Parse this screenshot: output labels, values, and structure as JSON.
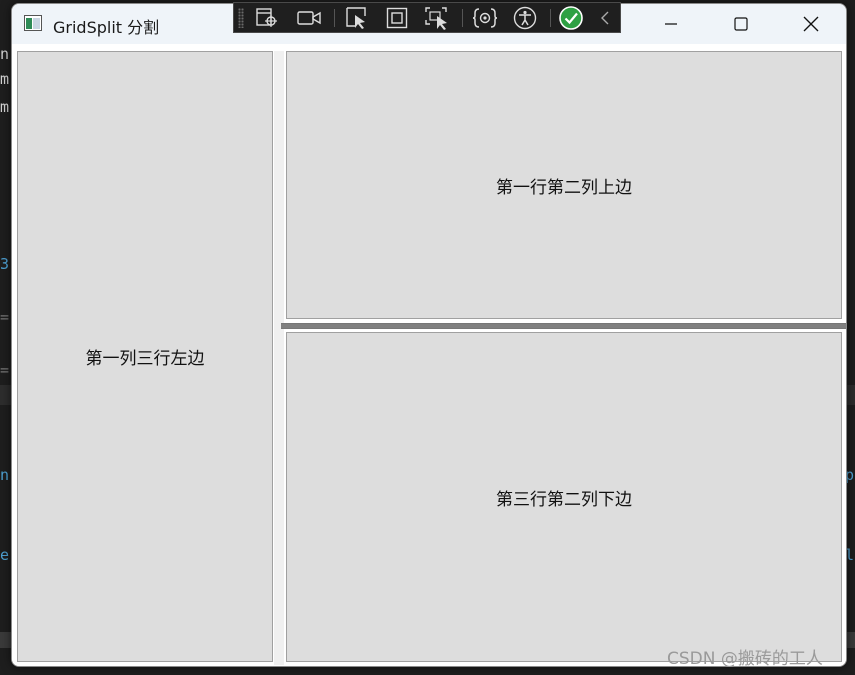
{
  "background": {
    "fragments": [
      "n",
      "m",
      "m",
      "3",
      "=",
      "=",
      "n",
      "e",
      "p",
      "l"
    ]
  },
  "window": {
    "title": "GridSplit 分割"
  },
  "debug_toolbar": {
    "tools": [
      "select-element-icon",
      "record-video-icon",
      "select-pointer-icon",
      "display-layout-adorners-icon",
      "track-focus-icon",
      "binding-failures-icon",
      "accessibility-icon",
      "checkmark-ok-icon",
      "collapse-toolbar-icon"
    ]
  },
  "grid": {
    "left_cell": "第一列三行左边",
    "top_right_cell": "第一行第二列上边",
    "bottom_right_cell": "第三行第二列下边"
  },
  "watermark": "CSDN @搬砖的工人",
  "colors": {
    "cell_background": "#dddddd",
    "titlebar": "#eff4f9",
    "toolbar_background": "#1f1f1f",
    "ok_green": "#3fb950"
  }
}
